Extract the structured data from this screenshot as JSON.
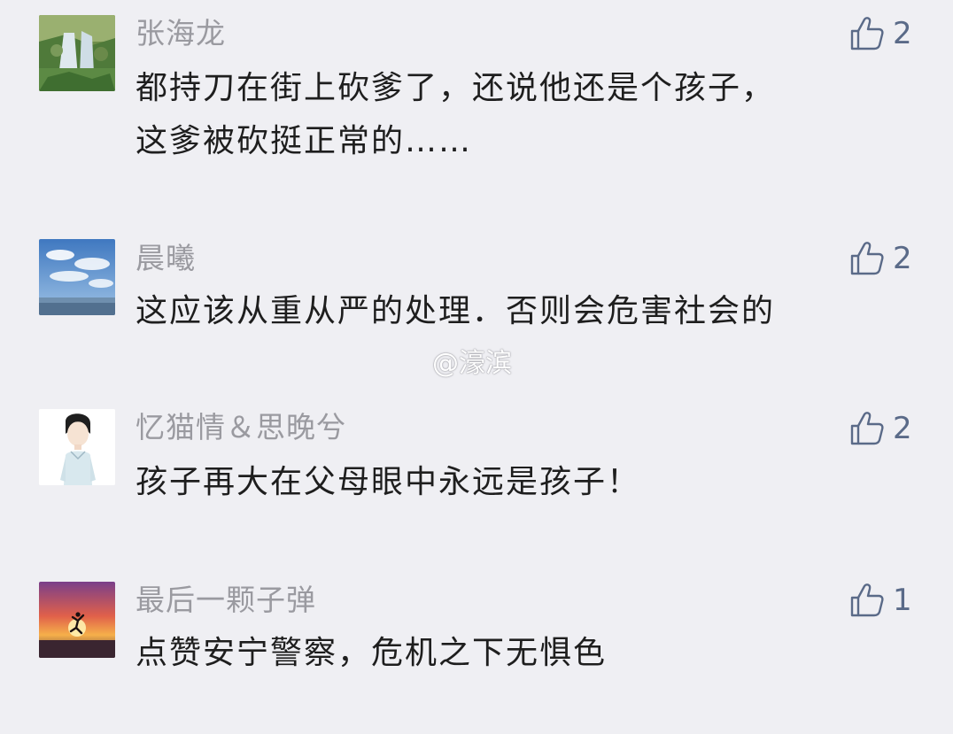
{
  "comments": [
    {
      "username": "张海龙",
      "text_line1": "都持刀在街上砍爹了，还说他还是个孩子，",
      "text_line2": "这爹被砍挺正常的……",
      "likes": "2",
      "avatar_icon": "waterfall-landscape-avatar"
    },
    {
      "username": "晨曦",
      "text_line1": "这应该从重从严的处理．否则会危害社会的",
      "likes": "2",
      "avatar_icon": "sky-clouds-avatar"
    },
    {
      "username": "忆猫情＆思晚兮",
      "text_line1": "孩子再大在父母眼中永远是孩子！",
      "likes": "2",
      "avatar_icon": "cartoon-boy-avatar"
    },
    {
      "username": "最后一颗子弹",
      "text_line1": "点赞安宁警察，危机之下无惧色",
      "likes": "1",
      "avatar_icon": "sunset-jump-avatar"
    }
  ],
  "watermark": "@濠滨",
  "colors": {
    "background": "#efeff3",
    "username": "#9a9aa0",
    "text": "#1e1e1e",
    "like_icon": "#5a6a88"
  }
}
